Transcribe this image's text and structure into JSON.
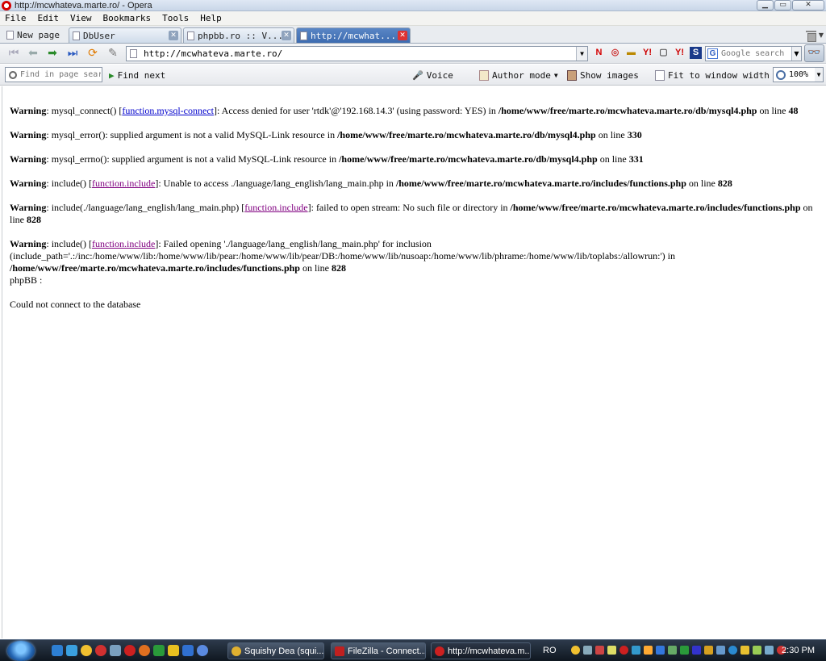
{
  "window": {
    "title": "http://mcwhateva.marte.ro/ - Opera",
    "min_label": "▁",
    "max_label": "▭",
    "close_label": "✕"
  },
  "menu": [
    "File",
    "Edit",
    "View",
    "Bookmarks",
    "Tools",
    "Help"
  ],
  "tabs": [
    {
      "label": "New page"
    },
    {
      "label": "DbUser"
    },
    {
      "label": "phpbb.ro :: V..."
    },
    {
      "label": "http://mcwhat..."
    }
  ],
  "nav": {
    "address": "http://mcwhateva.marte.ro/",
    "search_placeholder": "Google search"
  },
  "toolbar": {
    "find_placeholder": "Find in page search",
    "find_next": "Find next",
    "voice": "Voice",
    "author_mode": "Author mode",
    "show_images": "Show images",
    "fit_width": "Fit to window width",
    "zoom": "100%"
  },
  "page": {
    "warnings": [
      {
        "label": "Warning",
        "t1": ": mysql_connect() [",
        "link": "function.mysql-connect",
        "t2": "]: Access denied for user 'rtdk'@'192.168.14.3' (using password: YES) in ",
        "path": "/home/www/free/marte.ro/mcwhateva.marte.ro/db/mysql4.php",
        "t3": " on line ",
        "line": "48"
      },
      {
        "label": "Warning",
        "t1": ": mysql_error(): supplied argument is not a valid MySQL-Link resource in ",
        "path": "/home/www/free/marte.ro/mcwhateva.marte.ro/db/mysql4.php",
        "t3": " on line ",
        "line": "330"
      },
      {
        "label": "Warning",
        "t1": ": mysql_errno(): supplied argument is not a valid MySQL-Link resource in ",
        "path": "/home/www/free/marte.ro/mcwhateva.marte.ro/db/mysql4.php",
        "t3": " on line ",
        "line": "331"
      },
      {
        "label": "Warning",
        "t1": ": include() [",
        "link": "function.include",
        "t2": "]: Unable to access ./language/lang_english/lang_main.php in ",
        "path": "/home/www/free/marte.ro/mcwhateva.marte.ro/includes/functions.php",
        "t3": " on line ",
        "line": "828"
      },
      {
        "label": "Warning",
        "t1": ": include(./language/lang_english/lang_main.php) [",
        "link": "function.include",
        "t2": "]: failed to open stream: No such file or directory in ",
        "path": "/home/www/free/marte.ro/mcwhateva.marte.ro/includes/functions.php",
        "t3": " on line ",
        "line": "828"
      },
      {
        "label": "Warning",
        "t1": ": include() [",
        "link": "function.include",
        "t2": "]: Failed opening './language/lang_english/lang_main.php' for inclusion (include_path='.:/inc:/home/www/lib:/home/www/lib/pear:/home/www/lib/pear/DB:/home/www/lib/nusoap:/home/www/lib/phrame:/home/www/lib/toplabs:/allowrun:') in ",
        "path": "/home/www/free/marte.ro/mcwhateva.marte.ro/includes/functions.php",
        "t3": " on line ",
        "line": "828"
      }
    ],
    "phpbb_line": "phpBB :",
    "error_line": "Could not connect to the database"
  },
  "taskbar": {
    "tasks": [
      {
        "label": "Squishy Dea (squi..."
      },
      {
        "label": "FileZilla - Connect..."
      },
      {
        "label": "http://mcwhateva.m..."
      }
    ],
    "lang": "RO",
    "clock": "2:30 PM"
  }
}
